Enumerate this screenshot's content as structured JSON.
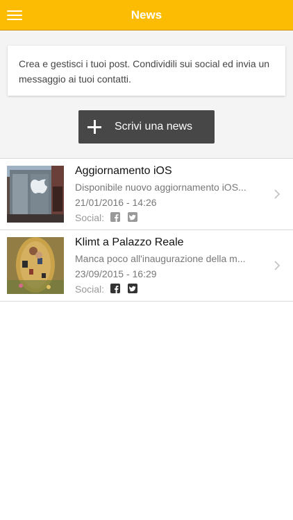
{
  "header": {
    "title": "News"
  },
  "intro": {
    "text": "Crea e gestisci i tuoi post. Condividili sui social ed invia un messaggio ai tuoi contatti."
  },
  "write_button": {
    "label": "Scrivi una news"
  },
  "news": [
    {
      "title": "Aggiornamento iOS",
      "description": "Disponibile nuovo aggiornamento iOS...",
      "date": "21/01/2016 - 14:26",
      "social_label": "Social:",
      "facebook_color": "#999999",
      "twitter_color": "#999999"
    },
    {
      "title": "Klimt a Palazzo Reale",
      "description": "Manca poco all'inaugurazione della m...",
      "date": "23/09/2015 - 16:29",
      "social_label": "Social:",
      "facebook_color": "#333333",
      "twitter_color": "#333333"
    }
  ],
  "colors": {
    "accent": "#fbbc03",
    "button": "#474747"
  }
}
